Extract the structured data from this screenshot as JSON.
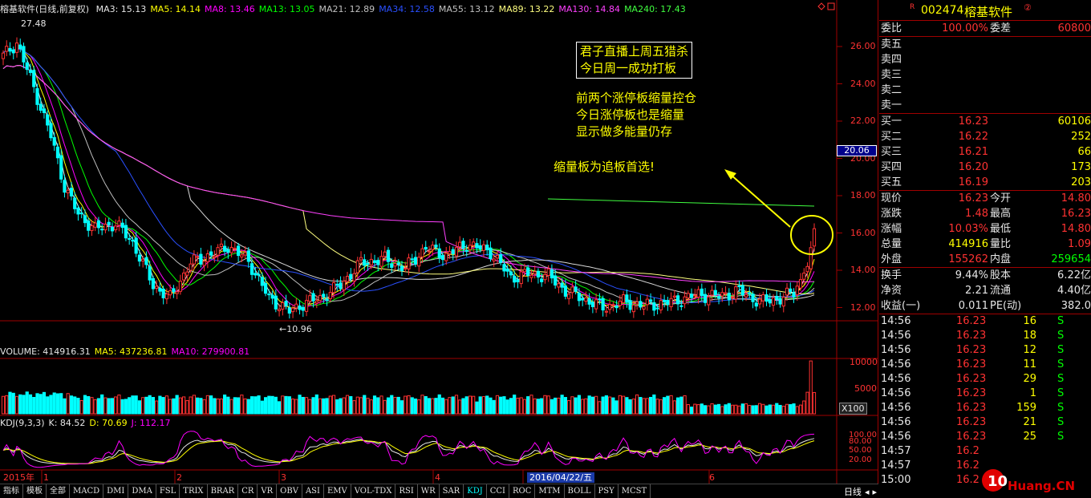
{
  "main_chart": {
    "title": "榕基软件(日线,前复权)",
    "ma_legend": [
      {
        "label": "MA3: 15.13",
        "color": "#e6e6e6"
      },
      {
        "label": "MA5: 14.14",
        "color": "#ffff00"
      },
      {
        "label": "MA8: 13.46",
        "color": "#ff00ff"
      },
      {
        "label": "MA13: 13.05",
        "color": "#00ff00"
      },
      {
        "label": "MA21: 12.89",
        "color": "#c0c0c0"
      },
      {
        "label": "MA34: 12.58",
        "color": "#2a50ff"
      },
      {
        "label": "MA55: 13.12",
        "color": "#c0c0c0"
      },
      {
        "label": "MA89: 13.22",
        "color": "#ffff80"
      },
      {
        "label": "MA130: 14.84",
        "color": "#ff40ff"
      },
      {
        "label": "MA240: 17.43",
        "color": "#40ff40"
      }
    ],
    "y_ticks": [
      "26.00",
      "24.00",
      "22.00",
      "20.00",
      "18.00",
      "16.00",
      "14.00",
      "12.00"
    ],
    "high_label": "27.48",
    "low_label": "←10.96",
    "current_price_tag": "20.06",
    "annotations": {
      "box_line1": "君子直播上周五猎杀",
      "box_line2": "今日周一成功打板",
      "text_line1": "前两个涨停板缩量控仓",
      "text_line2": "今日涨停板也是缩量",
      "text_line3": "显示做多能量仍存",
      "text_line4": "缩量板为追板首选!"
    },
    "colors": {
      "up": "#ff3232",
      "down": "#00ffff",
      "grid": "#a00000"
    }
  },
  "volume_chart": {
    "legend": [
      {
        "label": "VOLUME: 414916.31",
        "color": "#e6e6e6"
      },
      {
        "label": "MA5: 437236.81",
        "color": "#ffff00"
      },
      {
        "label": "MA10: 279900.81",
        "color": "#ff00ff"
      }
    ],
    "y_ticks": [
      "10000",
      "5000"
    ],
    "unit_label": "X100"
  },
  "kdj_chart": {
    "legend": [
      {
        "label": "KDJ(9,3,3)",
        "color": "#e6e6e6"
      },
      {
        "label": "K: 84.52",
        "color": "#e6e6e6"
      },
      {
        "label": "D: 70.69",
        "color": "#ffff00"
      },
      {
        "label": "J: 112.17",
        "color": "#ff00ff"
      }
    ],
    "y_ticks": [
      "100.00",
      "80.00",
      "50.00",
      "20.00"
    ]
  },
  "date_axis": {
    "labels": [
      "2015年",
      "1",
      "2",
      "3",
      "4",
      "2016/04/22/五",
      "6"
    ]
  },
  "toolbar": {
    "buttons": [
      "指标",
      "模板",
      "全部",
      "MACD",
      "DMI",
      "DMA",
      "FSL",
      "TRIX",
      "BRAR",
      "CR",
      "VR",
      "OBV",
      "ASI",
      "EMV",
      "VOL-TDX",
      "RSI",
      "WR",
      "SAR",
      "KDJ",
      "CCI",
      "ROC",
      "MTM",
      "BOLL",
      "PSY",
      "MCST"
    ],
    "active": "KDJ",
    "period": "日线"
  },
  "quote_panel": {
    "code": "002474",
    "name": "榕基软件",
    "badge": "R",
    "weibi_label": "委比",
    "weibi_value": "100.00%",
    "weicha_label": "委差",
    "weicha_value": "60800",
    "sell_rows": [
      {
        "label": "卖五",
        "price": "",
        "vol": ""
      },
      {
        "label": "卖四",
        "price": "",
        "vol": ""
      },
      {
        "label": "卖三",
        "price": "",
        "vol": ""
      },
      {
        "label": "卖二",
        "price": "",
        "vol": ""
      },
      {
        "label": "卖一",
        "price": "",
        "vol": ""
      }
    ],
    "buy_rows": [
      {
        "label": "买一",
        "price": "16.23",
        "vol": "60106"
      },
      {
        "label": "买二",
        "price": "16.22",
        "vol": "252"
      },
      {
        "label": "买三",
        "price": "16.21",
        "vol": "66"
      },
      {
        "label": "买四",
        "price": "16.20",
        "vol": "173"
      },
      {
        "label": "买五",
        "price": "16.19",
        "vol": "203"
      }
    ],
    "stats_a": [
      {
        "l1": "现价",
        "v1": "16.23",
        "c1": "red",
        "l2": "今开",
        "v2": "14.80",
        "c2": "red"
      },
      {
        "l1": "涨跌",
        "v1": "1.48",
        "c1": "red",
        "l2": "最高",
        "v2": "16.23",
        "c2": "red"
      },
      {
        "l1": "涨幅",
        "v1": "10.03%",
        "c1": "red",
        "l2": "最低",
        "v2": "14.80",
        "c2": "red"
      },
      {
        "l1": "总量",
        "v1": "414916",
        "c1": "yellow",
        "l2": "量比",
        "v2": "1.09",
        "c2": "red"
      },
      {
        "l1": "外盘",
        "v1": "155262",
        "c1": "red",
        "l2": "内盘",
        "v2": "259654",
        "c2": "green"
      }
    ],
    "stats_b": [
      {
        "l1": "换手",
        "v1": "9.44%",
        "c1": "white",
        "l2": "股本",
        "v2": "6.22亿",
        "c2": "white"
      },
      {
        "l1": "净资",
        "v1": "2.21",
        "c1": "white",
        "l2": "流通",
        "v2": "4.40亿",
        "c2": "white"
      },
      {
        "l1": "收益(一)",
        "v1": "0.011",
        "c1": "white",
        "l2": "PE(动)",
        "v2": "382.0",
        "c2": "white"
      }
    ],
    "ticks": [
      {
        "time": "14:56",
        "price": "16.23",
        "vol": "16",
        "side": "S"
      },
      {
        "time": "14:56",
        "price": "16.23",
        "vol": "18",
        "side": "S"
      },
      {
        "time": "14:56",
        "price": "16.23",
        "vol": "12",
        "side": "S"
      },
      {
        "time": "14:56",
        "price": "16.23",
        "vol": "11",
        "side": "S"
      },
      {
        "time": "14:56",
        "price": "16.23",
        "vol": "29",
        "side": "S"
      },
      {
        "time": "14:56",
        "price": "16.23",
        "vol": "1",
        "side": "S"
      },
      {
        "time": "14:56",
        "price": "16.23",
        "vol": "159",
        "side": "S"
      },
      {
        "time": "14:56",
        "price": "16.23",
        "vol": "21",
        "side": "S"
      },
      {
        "time": "14:56",
        "price": "16.23",
        "vol": "25",
        "side": "S"
      },
      {
        "time": "14:57",
        "price": "16.2",
        "vol": "",
        "side": ""
      },
      {
        "time": "14:57",
        "price": "16.2",
        "vol": "",
        "side": ""
      },
      {
        "time": "15:00",
        "price": "16.2",
        "vol": "",
        "side": ""
      }
    ],
    "watermark": "Huang.CN"
  }
}
